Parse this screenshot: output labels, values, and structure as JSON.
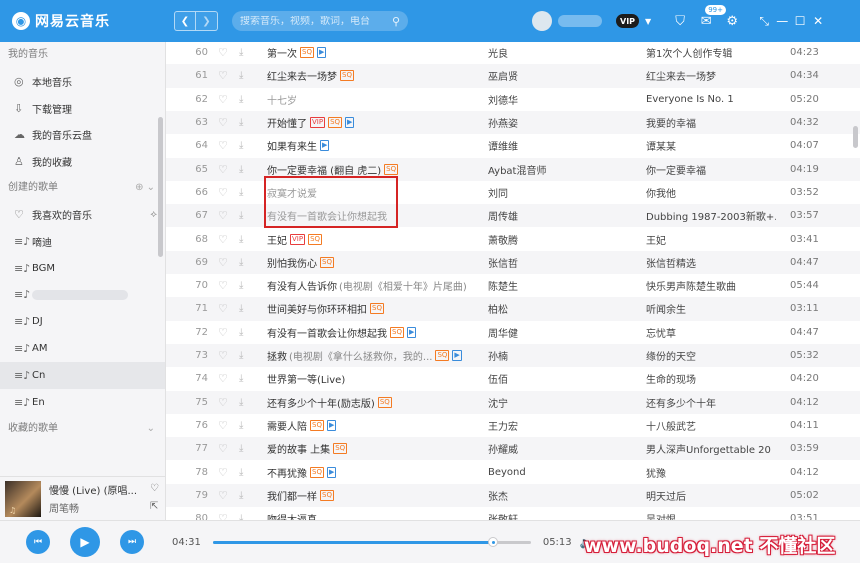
{
  "app": {
    "title": "网易云音乐",
    "logo_glyph": "◉"
  },
  "header": {
    "search_placeholder": "搜索音乐，视频，歌词，电台",
    "vip_label": "VIP",
    "mail_badge": "99+",
    "back_glyph": "❮",
    "forward_glyph": "❯",
    "search_glyph": "⚲",
    "shirt_glyph": "⛉",
    "mail_glyph": "✉",
    "gear_glyph": "⚙",
    "dropdown_glyph": "▼",
    "miniplayer_glyph": "⤡",
    "minimize_glyph": "—",
    "maximize_glyph": "☐",
    "close_glyph": "✕"
  },
  "sidebar": {
    "my_music_title": "我的音乐",
    "my_music": [
      {
        "icon": "◎",
        "label": "本地音乐"
      },
      {
        "icon": "⇩",
        "label": "下载管理"
      },
      {
        "icon": "☁",
        "label": "我的音乐云盘"
      },
      {
        "icon": "♙",
        "label": "我的收藏"
      }
    ],
    "created_title": "创建的歌单",
    "created_actions": "⊕ ⌄",
    "created": [
      {
        "icon": "♡",
        "label": "我喜欢的音乐",
        "right_icon": "⟡"
      },
      {
        "icon": "≡♪",
        "label": "嘀迪"
      },
      {
        "icon": "≡♪",
        "label": "BGM"
      },
      {
        "icon": "≡♪",
        "label": ""
      },
      {
        "icon": "≡♪",
        "label": "DJ"
      },
      {
        "icon": "≡♪",
        "label": "AM"
      },
      {
        "icon": "≡♪",
        "label": "Cn"
      },
      {
        "icon": "≡♪",
        "label": "En"
      }
    ],
    "collected_title": "收藏的歌单",
    "collected_arrow": "⌄"
  },
  "now_playing": {
    "title": "慢慢 (Live) (原唱...",
    "artist": "周笔畅",
    "like_glyph": "♡",
    "share_glyph": "⇱",
    "cover_glyph": "♫"
  },
  "songs": [
    {
      "num": "60",
      "title": "第一次",
      "sub": "",
      "tags": [
        "SQ",
        "MV"
      ],
      "artist": "光良",
      "album": "第1次个人创作专辑",
      "time": "04:23",
      "grey": false
    },
    {
      "num": "61",
      "title": "红尘来去一场梦",
      "sub": "",
      "tags": [
        "SQ"
      ],
      "artist": "巫启贤",
      "album": "红尘来去一场梦",
      "time": "04:34",
      "grey": false
    },
    {
      "num": "62",
      "title": "十七岁",
      "sub": "",
      "tags": [],
      "artist": "刘德华",
      "album": "Everyone Is No. 1",
      "time": "05:20",
      "grey": true
    },
    {
      "num": "63",
      "title": "开始懂了",
      "sub": "",
      "tags": [
        "VIP",
        "SQ",
        "MV"
      ],
      "artist": "孙燕姿",
      "album": "我要的幸福",
      "time": "04:32",
      "grey": false
    },
    {
      "num": "64",
      "title": "如果有来生",
      "sub": "",
      "tags": [
        "MV"
      ],
      "artist": "谭维维",
      "album": "谭某某",
      "time": "04:07",
      "grey": false
    },
    {
      "num": "65",
      "title": "你一定要幸福 (翻自 虎二)",
      "sub": "",
      "tags": [
        "SQ"
      ],
      "artist": "Aybat混音师",
      "album": "你一定要幸福",
      "time": "04:19",
      "grey": false
    },
    {
      "num": "66",
      "title": "寂寞才说爱",
      "sub": "",
      "tags": [],
      "artist": "刘同",
      "album": "你我他",
      "time": "03:52",
      "grey": true
    },
    {
      "num": "67",
      "title": "有没有一首歌会让你想起我",
      "sub": "",
      "tags": [],
      "artist": "周传雄",
      "album": "Dubbing 1987-2003新歌+...",
      "time": "03:57",
      "grey": true
    },
    {
      "num": "68",
      "title": "王妃",
      "sub": "",
      "tags": [
        "VIP",
        "SQ"
      ],
      "artist": "萧敬腾",
      "album": "王妃",
      "time": "03:41",
      "grey": false
    },
    {
      "num": "69",
      "title": "别怕我伤心",
      "sub": "",
      "tags": [
        "SQ"
      ],
      "artist": "张信哲",
      "album": "张信哲精选",
      "time": "04:47",
      "grey": false
    },
    {
      "num": "70",
      "title": "有没有人告诉你",
      "sub": "(电视剧《相爱十年》片尾曲)",
      "tags": [],
      "artist": "陈楚生",
      "album": "快乐男声陈楚生歌曲",
      "time": "05:44",
      "grey": false
    },
    {
      "num": "71",
      "title": "世间美好与你环环相扣",
      "sub": "",
      "tags": [
        "SQ"
      ],
      "artist": "柏松",
      "album": "听闻余生",
      "time": "03:11",
      "grey": false
    },
    {
      "num": "72",
      "title": "有没有一首歌会让你想起我",
      "sub": "",
      "tags": [
        "SQ",
        "MV"
      ],
      "artist": "周华健",
      "album": "忘忧草",
      "time": "04:47",
      "grey": false
    },
    {
      "num": "73",
      "title": "拯救",
      "sub": "(电视剧《拿什么拯救你，我的...",
      "tags": [
        "SQ",
        "MV"
      ],
      "artist": "孙楠",
      "album": "缘份的天空",
      "time": "05:32",
      "grey": false
    },
    {
      "num": "74",
      "title": "世界第一等(Live)",
      "sub": "",
      "tags": [],
      "artist": "伍佰",
      "album": "生命的现场",
      "time": "04:20",
      "grey": false
    },
    {
      "num": "75",
      "title": "还有多少个十年(励志版)",
      "sub": "",
      "tags": [
        "SQ"
      ],
      "artist": "沈宁",
      "album": "还有多少个十年",
      "time": "04:12",
      "grey": false
    },
    {
      "num": "76",
      "title": "需要人陪",
      "sub": "",
      "tags": [
        "SQ",
        "MV"
      ],
      "artist": "王力宏",
      "album": "十八般武艺",
      "time": "04:11",
      "grey": false
    },
    {
      "num": "77",
      "title": "爱的故事 上集",
      "sub": "",
      "tags": [
        "SQ"
      ],
      "artist": "孙耀威",
      "album": "男人深声Unforgettable 20",
      "time": "03:59",
      "grey": false
    },
    {
      "num": "78",
      "title": "不再犹豫",
      "sub": "",
      "tags": [
        "SQ",
        "MV"
      ],
      "artist": "Beyond",
      "album": "犹豫",
      "time": "04:12",
      "grey": false
    },
    {
      "num": "79",
      "title": "我们都一样",
      "sub": "",
      "tags": [
        "SQ"
      ],
      "artist": "张杰",
      "album": "明天过后",
      "time": "05:02",
      "grey": false
    },
    {
      "num": "80",
      "title": "吻得太逼真",
      "sub": "",
      "tags": [],
      "artist": "张敬轩",
      "album": "吴对恨",
      "time": "03:51",
      "grey": false
    }
  ],
  "icons": {
    "like": "♡",
    "download": "⤓"
  },
  "player": {
    "current_time": "04:31",
    "total_time": "05:13",
    "progress": 0.88,
    "prev_glyph": "⏮",
    "play_glyph": "▶",
    "next_glyph": "⏭",
    "volume_glyph": "🔈"
  },
  "watermark": "www.budoq.net 不懂社区",
  "colors": {
    "brand": "#2f97e6",
    "highlight": "#d52424"
  }
}
